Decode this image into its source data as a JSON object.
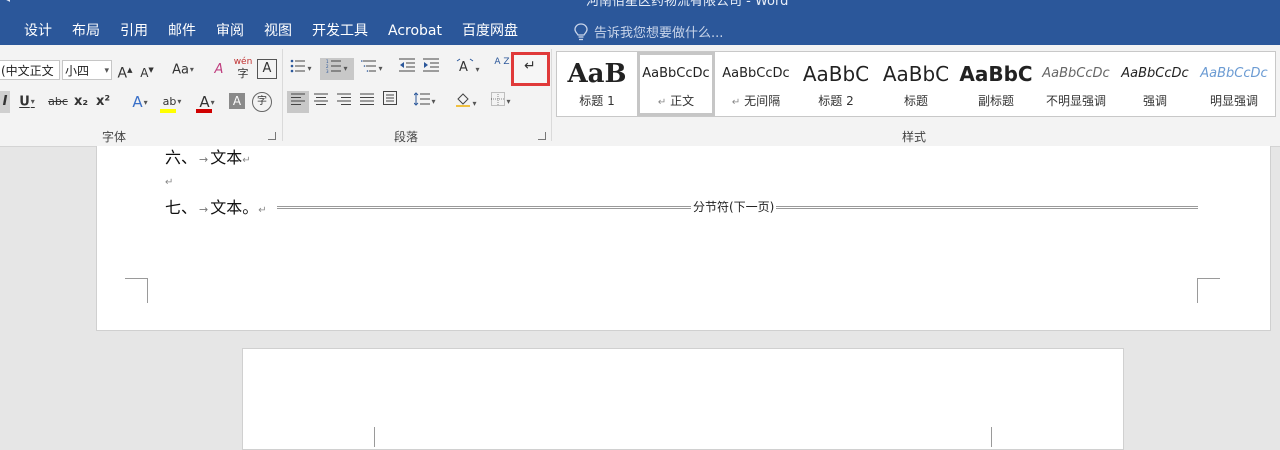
{
  "titlebar": {
    "doc_title": "河南佰星区药物流有限公司 - Word"
  },
  "tabs": [
    "设计",
    "布局",
    "引用",
    "邮件",
    "审阅",
    "视图",
    "开发工具",
    "Acrobat",
    "百度网盘"
  ],
  "tell_me": {
    "placeholder": "告诉我您想要做什么..."
  },
  "font_group": {
    "label": "字体",
    "font_name": "(中文正文",
    "font_size": "小四",
    "grow_label": "A",
    "shrink_label": "A",
    "change_case_label": "Aa",
    "clear_format_label": "A",
    "phonetic_label": "wén",
    "border_char_label": "A",
    "italic_label": "I",
    "underline_label": "U",
    "strike_label": "abc",
    "subscript_label": "x₂",
    "superscript_label": "x²",
    "text_effect_label": "A",
    "highlight_label": "ab",
    "font_color_label": "A",
    "shading_label": "A",
    "enclose_label": "字",
    "highlight_color": "#ffff00",
    "font_color": "#d00000"
  },
  "paragraph_group": {
    "label": "段落",
    "sort_label": "A Z",
    "show_marks_symbol": "↵",
    "asian_layout_label": "A"
  },
  "styles_group": {
    "label": "样式",
    "styles": [
      {
        "preview": "AaB",
        "name": "标题 1"
      },
      {
        "preview": "AaBbCcDc",
        "name": "正文"
      },
      {
        "preview": "AaBbCcDc",
        "name": "无间隔"
      },
      {
        "preview": "AaBbC",
        "name": "标题 2"
      },
      {
        "preview": "AaBbC",
        "name": "标题"
      },
      {
        "preview": "AaBbC",
        "name": "副标题"
      },
      {
        "preview": "AaBbCcDc",
        "name": "不明显强调"
      },
      {
        "preview": "AaBbCcDc",
        "name": "强调"
      },
      {
        "preview": "AaBbCcDc",
        "name": "明显强调"
      }
    ]
  },
  "document": {
    "line6_num": "六、",
    "line6_text": "文本",
    "line7_num": "七、",
    "line7_text": "文本。",
    "section_break_label": "分节符(下一页)",
    "para_mark": "↵",
    "tab_mark": "→"
  },
  "colors": {
    "ribbon_blue": "#2b579a",
    "highlight_red": "#e03a3a"
  }
}
